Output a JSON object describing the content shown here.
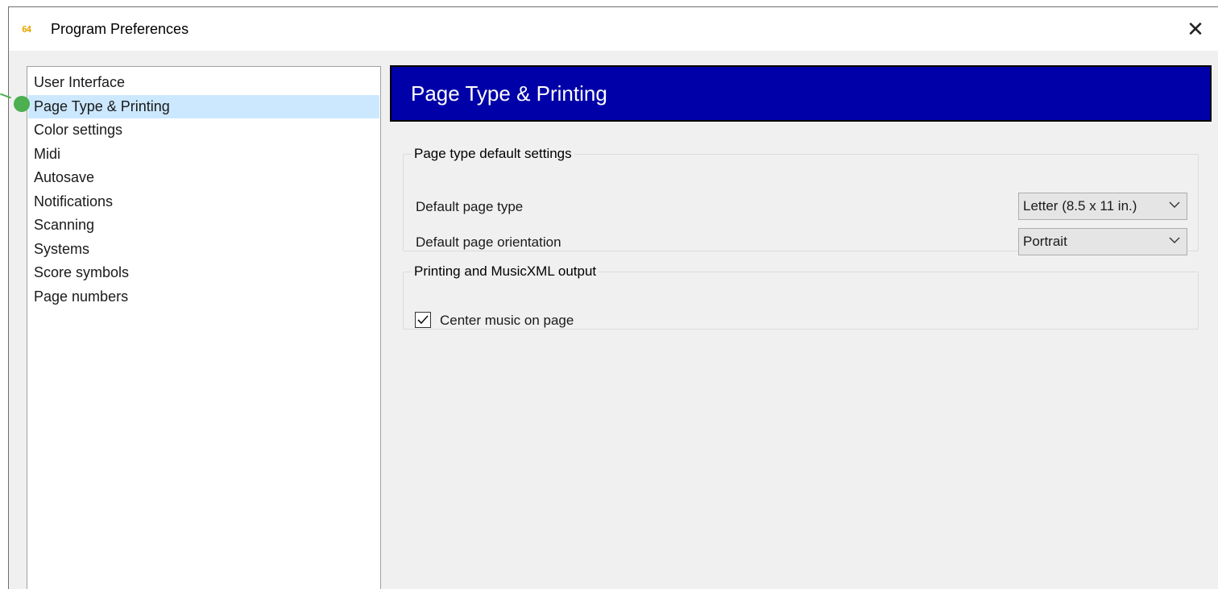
{
  "window": {
    "app_icon_text": "64",
    "title": "Program Preferences",
    "close_glyph": "✕"
  },
  "sidebar": {
    "items": [
      {
        "label": "User Interface"
      },
      {
        "label": "Page Type & Printing",
        "selected": true
      },
      {
        "label": "Color settings"
      },
      {
        "label": "Midi"
      },
      {
        "label": "Autosave"
      },
      {
        "label": "Notifications"
      },
      {
        "label": "Scanning"
      },
      {
        "label": "Systems"
      },
      {
        "label": "Score symbols"
      },
      {
        "label": "Page numbers"
      }
    ]
  },
  "main": {
    "banner_title": "Page Type & Printing",
    "page_type_group": {
      "legend": "Page type default settings",
      "default_page_type_label": "Default page type",
      "default_page_type_value": "Letter (8.5 x 11 in.)",
      "default_orientation_label": "Default page orientation",
      "default_orientation_value": "Portrait"
    },
    "printing_group": {
      "legend": "Printing and MusicXML output",
      "center_music_label": "Center music on page",
      "center_music_checked": true
    }
  },
  "colors": {
    "banner_bg": "#0000a8",
    "selection_bg": "#cce8ff",
    "marker": "#4caf50"
  }
}
